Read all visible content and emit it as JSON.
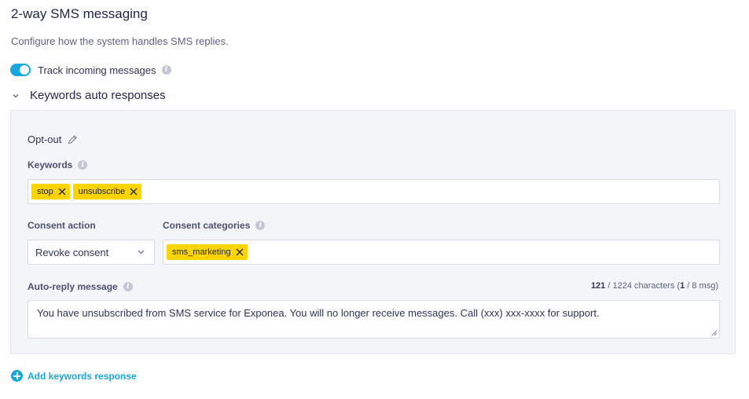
{
  "header": {
    "title": "2-way SMS messaging",
    "subtitle": "Configure how the system handles SMS replies."
  },
  "track_incoming": {
    "label": "Track incoming messages",
    "enabled": true
  },
  "keywords_section": {
    "title": "Keywords auto responses",
    "expanded": true
  },
  "response": {
    "name": "Opt-out",
    "keywords_label": "Keywords",
    "keywords": [
      "stop",
      "unsubscribe"
    ],
    "consent_action_label": "Consent action",
    "consent_action_value": "Revoke consent",
    "consent_categories_label": "Consent categories",
    "consent_categories": [
      "sms_marketing"
    ],
    "auto_reply_label": "Auto-reply message",
    "counter": {
      "chars": "121",
      "chars_rest": " / 1224 characters (",
      "msgs": "1",
      "msgs_rest": " / 8 msg)"
    },
    "auto_reply_text": "You have unsubscribed from SMS service for Exponea. You will no longer receive messages. Call (xxx) xxx-xxxx for support."
  },
  "add_button": {
    "label": "Add keywords response"
  },
  "colors": {
    "accent": "#18a7dc",
    "chip": "#fcd400",
    "panel": "#f4f5f9"
  }
}
